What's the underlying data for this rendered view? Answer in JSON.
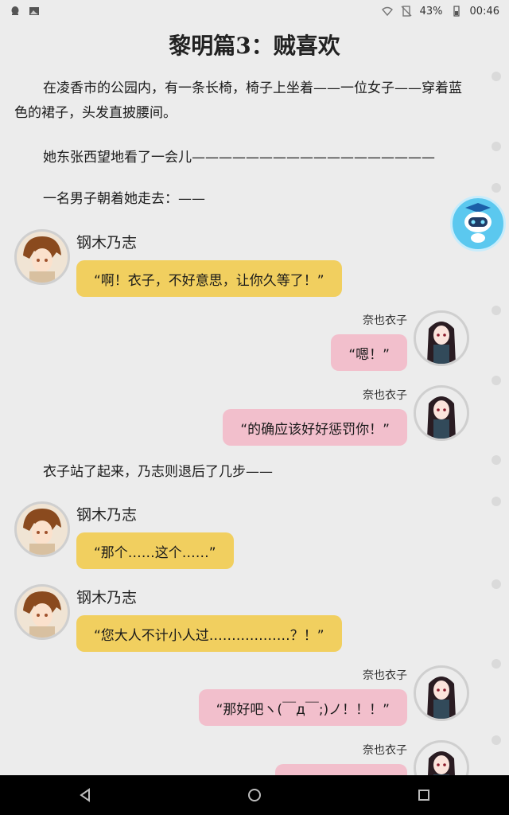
{
  "status_bar": {
    "battery": "43%",
    "time": "00:46"
  },
  "chapter": {
    "title": "黎明篇3：贼喜欢"
  },
  "narration": {
    "p1": "在凌香市的公园内，有一条长椅，椅子上坐着——一位女子——穿着蓝色的裙子，头发直披腰间。",
    "p2": "她东张西望地看了一会儿——————————————————",
    "p3": "一名男子朝着她走去：——",
    "p4": "衣子站了起来，乃志则退后了几步——"
  },
  "dialogue": [
    {
      "speaker": "钢木乃志",
      "text": "“啊！衣子，不好意思，让你久等了！”"
    },
    {
      "speaker": "奈也衣子",
      "text": "“嗯！”"
    },
    {
      "speaker": "奈也衣子",
      "text": "“的确应该好好惩罚你！”"
    },
    {
      "speaker": "钢木乃志",
      "text": "“那个……这个……”"
    },
    {
      "speaker": "钢木乃志",
      "text": "“您大人不计小人过………………？！”"
    },
    {
      "speaker": "奈也衣子",
      "text": "“那好吧ヽ(￣д￣;)ノ！！！”"
    },
    {
      "speaker": "奈也衣子",
      "text": ""
    }
  ],
  "colors": {
    "male_bubble": "#f1cf5f",
    "female_bubble": "#f2bfcc",
    "background": "#ececec"
  },
  "icons": {
    "status_left": [
      "notification-icon",
      "image-icon"
    ],
    "status_right": [
      "wifi-icon",
      "no-sim-icon",
      "battery-icon"
    ],
    "nav": [
      "back-icon",
      "home-icon",
      "recents-icon"
    ],
    "floating": "robot-assistant-icon"
  }
}
